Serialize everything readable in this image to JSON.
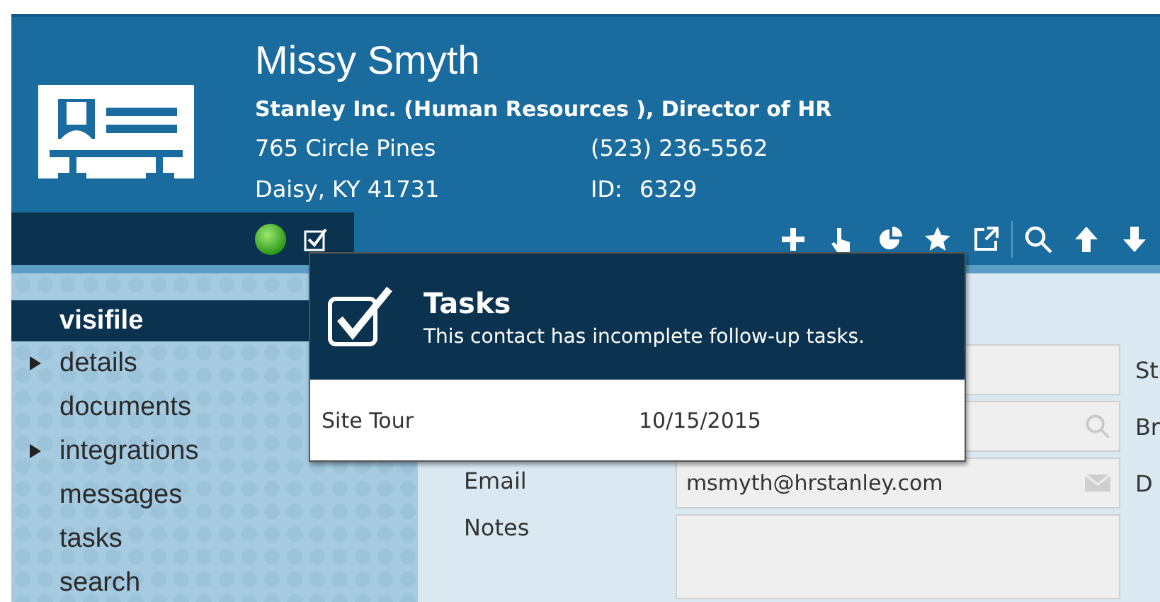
{
  "contact": {
    "name": "Missy Smyth",
    "company": "Stanley Inc.  (Human Resources ), Director of HR",
    "address_line_1": "765 Circle Pines",
    "address_line_2": "Daisy, KY   41731",
    "phone": "(523) 236-5562",
    "id_label": "ID:",
    "id_value": "6329"
  },
  "status": {
    "online": true,
    "tasks_checked": true
  },
  "toolbar": [
    {
      "kind": "add"
    },
    {
      "kind": "pointer"
    },
    {
      "kind": "pie"
    },
    {
      "kind": "star"
    },
    {
      "kind": "export"
    },
    {
      "kind": "search"
    },
    {
      "kind": "up"
    },
    {
      "kind": "down"
    }
  ],
  "sidebar": {
    "items": [
      {
        "label": "visifile",
        "selected": true,
        "expandable": false
      },
      {
        "label": "details",
        "selected": false,
        "expandable": true
      },
      {
        "label": "documents",
        "selected": false,
        "expandable": false
      },
      {
        "label": "integrations",
        "selected": false,
        "expandable": true
      },
      {
        "label": "messages",
        "selected": false,
        "expandable": false
      },
      {
        "label": "tasks",
        "selected": false,
        "expandable": false
      },
      {
        "label": "search",
        "selected": false,
        "expandable": false
      }
    ]
  },
  "form": {
    "rows": [
      {
        "kind": "text",
        "side_label": "St"
      },
      {
        "kind": "lookup",
        "side_label": "Br"
      },
      {
        "kind": "email",
        "label": "Email",
        "value": "msmyth@hrstanley.com",
        "side_label": "D"
      },
      {
        "kind": "notes",
        "label": "Notes"
      }
    ]
  },
  "tasks_popup": {
    "title": "Tasks",
    "message": "This contact has incomplete follow-up tasks.",
    "tasks": [
      {
        "name": "Site Tour",
        "date": "10/15/2015"
      }
    ]
  }
}
